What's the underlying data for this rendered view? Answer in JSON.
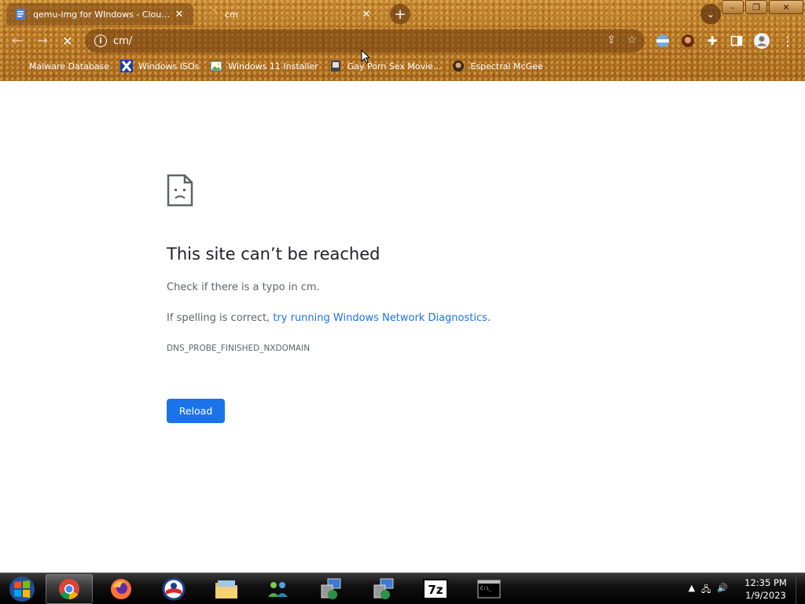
{
  "browser": {
    "tabs": [
      {
        "title": "qemu-img for WIndows - Cloudbase",
        "active": true
      },
      {
        "title": "cm",
        "active": false
      }
    ],
    "new_tab_label": "+",
    "address": "cm/",
    "bookmarks": [
      {
        "label": "Malware Database",
        "icon": "folder-icon"
      },
      {
        "label": "Windows ISOs",
        "icon": "x-logo-icon"
      },
      {
        "label": "Windows 11 Installer",
        "icon": "image-icon"
      },
      {
        "label": "Gay Porn Sex Movie...",
        "icon": "avatar-icon"
      },
      {
        "label": "Espectral McGee",
        "icon": "avatar-icon"
      }
    ]
  },
  "error_page": {
    "title": "This site can’t be reached",
    "line1": "Check if there is a typo in cm.",
    "line2_prefix": "If spelling is correct, ",
    "line2_link": "try running Windows Network Diagnostics",
    "line2_suffix": ".",
    "code": "DNS_PROBE_FINISHED_NXDOMAIN",
    "reload_label": "Reload"
  },
  "taskbar": {
    "time": "12:35 PM",
    "date": "1/9/2023",
    "apps": [
      "chrome-icon",
      "firefox-icon",
      "obama-logo-icon",
      "file-explorer-icon",
      "network-users-icon",
      "remote-desktop-icon",
      "remote-desktop-icon",
      "7zip-icon",
      "command-prompt-icon"
    ]
  },
  "colors": {
    "accent": "#1a73e8",
    "theme": "#b9741f",
    "text": "#202124",
    "muted": "#5f6368"
  }
}
